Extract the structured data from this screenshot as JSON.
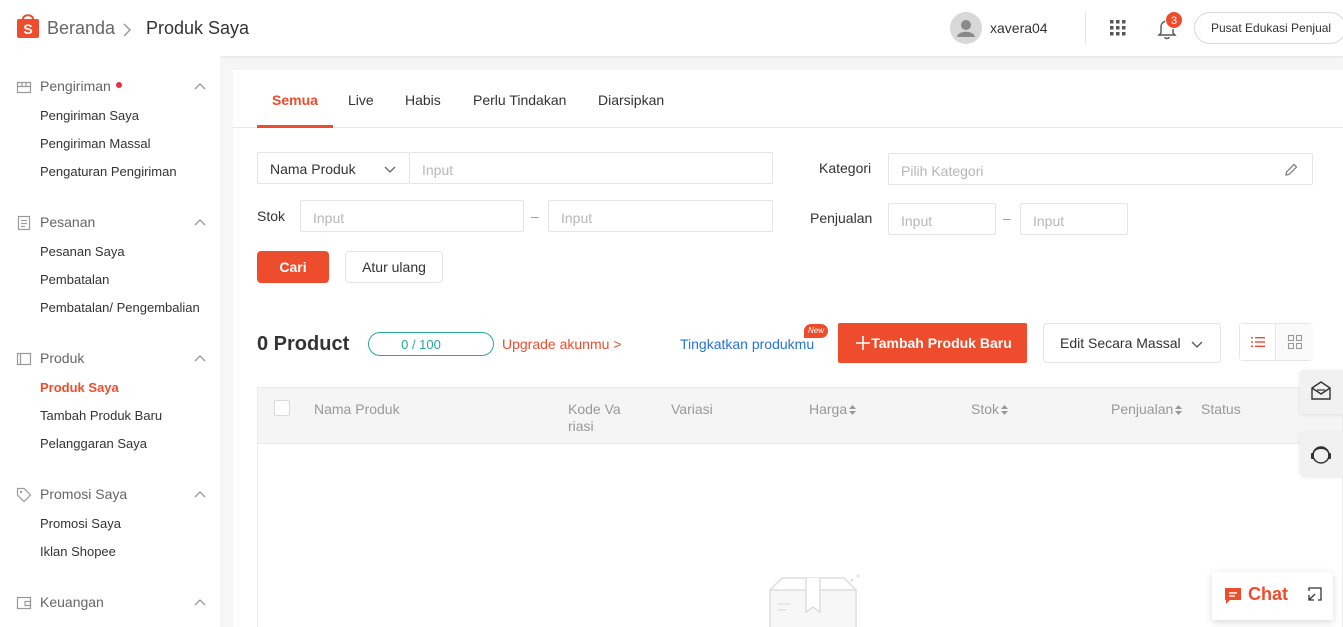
{
  "header": {
    "breadcrumb_home": "Beranda",
    "breadcrumb_separator": ">",
    "breadcrumb_current": "Produk Saya",
    "username": "xavera04",
    "notification_count": "3",
    "edu_button": "Pusat Edukasi Penjual"
  },
  "sidebar": {
    "sections": [
      {
        "title": "Pengiriman",
        "icon": "truck-icon",
        "items": [
          "Pengiriman Saya",
          "Pengiriman Massal",
          "Pengaturan Pengiriman"
        ]
      },
      {
        "title": "Pesanan",
        "icon": "clipboard-icon",
        "items": [
          "Pesanan Saya",
          "Pembatalan",
          "Pembatalan/ Pengembalian"
        ]
      },
      {
        "title": "Produk",
        "icon": "box-icon",
        "items": [
          "Produk Saya",
          "Tambah Produk Baru",
          "Pelanggaran Saya"
        ]
      },
      {
        "title": "Promosi Saya",
        "icon": "tag-icon",
        "items": [
          "Promosi Saya",
          "Iklan Shopee"
        ]
      },
      {
        "title": "Keuangan",
        "icon": "wallet-icon",
        "items": []
      }
    ],
    "active_item": "Produk Saya"
  },
  "tabs": [
    "Semua",
    "Live",
    "Habis",
    "Perlu Tindakan",
    "Diarsipkan"
  ],
  "active_tab": "Semua",
  "filters": {
    "search_field_select": "Nama Produk",
    "search_placeholder": "Input",
    "stok_label": "Stok",
    "stok_min_placeholder": "Input",
    "stok_max_placeholder": "Input",
    "kategori_label": "Kategori",
    "kategori_placeholder": "Pilih Kategori",
    "penjualan_label": "Penjualan",
    "penjualan_min_placeholder": "Input",
    "penjualan_max_placeholder": "Input",
    "range_separator": "–",
    "search_button": "Cari",
    "reset_button": "Atur ulang"
  },
  "products": {
    "count_title": "0 Product",
    "quota_text": "0 / 100",
    "quota_fraction": 0,
    "upgrade_link": "Upgrade akunmu >",
    "improve_link": "Tingkatkan produkmu",
    "new_badge": "New",
    "add_button": "Tambah Produk Baru",
    "bulk_edit_button": "Edit Secara Massal"
  },
  "table": {
    "columns": [
      {
        "label": "Nama Produk",
        "sortable": false
      },
      {
        "label": "Kode Va riasi",
        "sortable": false
      },
      {
        "label": "Variasi",
        "sortable": false
      },
      {
        "label": "Harga",
        "sortable": true
      },
      {
        "label": "Stok",
        "sortable": true
      },
      {
        "label": "Penjualan",
        "sortable": true
      },
      {
        "label": "Status",
        "sortable": false
      }
    ]
  },
  "chat": {
    "label": "Chat"
  },
  "colors": {
    "brand": "#ee4d2d",
    "quota": "#26aa99",
    "link": "#2673dd"
  }
}
